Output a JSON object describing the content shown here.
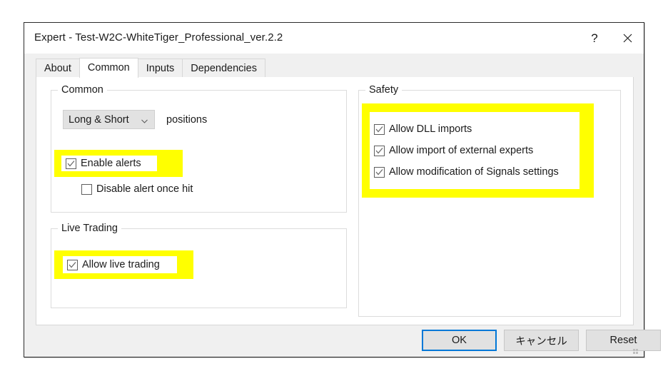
{
  "window": {
    "title": "Expert - Test-W2C-WhiteTiger_Professional_ver.2.2",
    "help_icon": "question-mark-icon",
    "close_icon": "close-x-icon"
  },
  "tabs": [
    {
      "label": "About",
      "selected": false
    },
    {
      "label": "Common",
      "selected": true
    },
    {
      "label": "Inputs",
      "selected": false
    },
    {
      "label": "Dependencies",
      "selected": false
    }
  ],
  "groups": {
    "common": {
      "legend": "Common",
      "positions": {
        "selected": "Long & Short",
        "arrow_icon": "chevron-down-icon",
        "suffix_label": "positions"
      },
      "enable_alerts": {
        "label": "Enable alerts",
        "checked": true,
        "highlighted": true
      },
      "disable_alert_once_hit": {
        "label": "Disable alert once hit",
        "checked": false,
        "highlighted": false
      }
    },
    "live_trading": {
      "legend": "Live Trading",
      "allow_live_trading": {
        "label": "Allow live trading",
        "checked": true,
        "highlighted": true
      }
    },
    "safety": {
      "legend": "Safety",
      "items": [
        {
          "label": "Allow DLL imports",
          "checked": true
        },
        {
          "label": "Allow import of external experts",
          "checked": true
        },
        {
          "label": "Allow modification of Signals settings",
          "checked": true
        }
      ],
      "highlighted": true
    }
  },
  "footer": {
    "ok_label": "OK",
    "cancel_label": "キャンセル",
    "reset_label": "Reset"
  },
  "colors": {
    "highlight": "#ffff00",
    "focus_border": "#0078d7",
    "dialog_face": "#f0f0f0",
    "page": "#ffffff"
  }
}
